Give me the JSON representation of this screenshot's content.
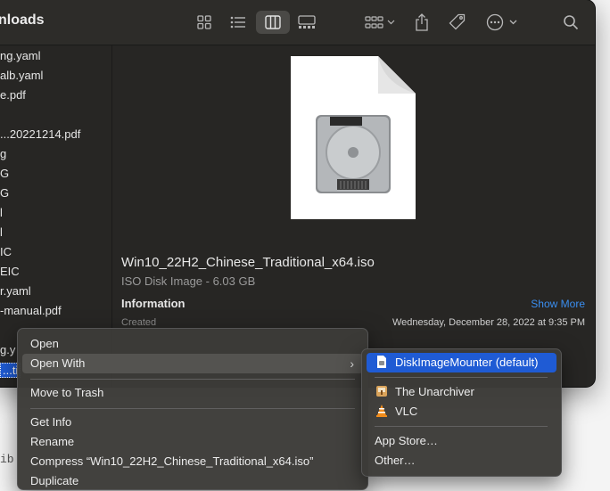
{
  "window": {
    "title": "nloads",
    "toolbar": {
      "icons": [
        "grid-view-icon",
        "list-view-icon",
        "column-view-icon",
        "gallery-view-icon",
        "group-icon",
        "share-icon",
        "tag-icon",
        "more-actions-icon",
        "search-icon"
      ]
    }
  },
  "sidebar": {
    "items": [
      "ng.yaml",
      "alb.yaml",
      "e.pdf",
      "...20221214.pdf",
      "g",
      "G",
      "G",
      "l",
      "l",
      "IC",
      "EIC",
      "r.yaml",
      "-manual.pdf",
      "g.y",
      "...ti"
    ]
  },
  "preview": {
    "file_name": "Win10_22H2_Chinese_Traditional_x64.iso",
    "file_type": "ISO Disk Image - 6.03 GB",
    "info_heading": "Information",
    "show_more": "Show More",
    "created_label": "Created",
    "created_value": "Wednesday, December 28, 2022 at 9:35 PM"
  },
  "context_menu": {
    "open": "Open",
    "open_with": "Open With",
    "move_to_trash": "Move to Trash",
    "get_info": "Get Info",
    "rename": "Rename",
    "compress": "Compress “Win10_22H2_Chinese_Traditional_x64.iso”",
    "duplicate": "Duplicate"
  },
  "open_with_menu": {
    "disk_image_mounter": "DiskImageMounter (default)",
    "unarchiver": "The Unarchiver",
    "vlc": "VLC",
    "app_store": "App Store…",
    "other": "Other…"
  },
  "underlay_text": "ib",
  "colors": {
    "accent": "#1f5bd4",
    "link": "#3a8ef0",
    "window_bg": "#272624"
  }
}
